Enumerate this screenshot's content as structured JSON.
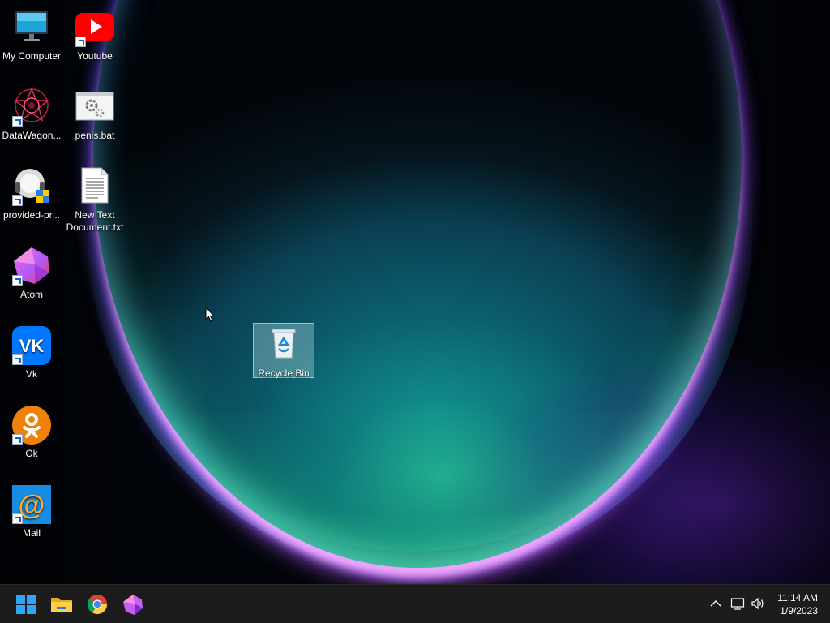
{
  "desktop": {
    "icons": [
      {
        "label": "My Computer",
        "icon": "monitor-icon"
      },
      {
        "label": "Youtube",
        "icon": "youtube-icon"
      },
      {
        "label": "DataWagon...",
        "icon": "datawagon-icon"
      },
      {
        "label": "penis.bat",
        "icon": "bat-file-icon"
      },
      {
        "label": "provided-pr...",
        "icon": "provided-app-icon"
      },
      {
        "label": "New Text Document.txt",
        "icon": "text-file-icon"
      },
      {
        "label": "Atom",
        "icon": "atom-icon"
      },
      {
        "label": "Vk",
        "icon": "vk-icon"
      },
      {
        "label": "Ok",
        "icon": "ok-icon"
      },
      {
        "label": "Mail",
        "icon": "mail-icon"
      },
      {
        "label": "Recycle Bin",
        "icon": "recycle-bin-icon"
      }
    ]
  },
  "taskbar": {
    "apps": [
      {
        "name": "Start",
        "icon": "windows-start-icon"
      },
      {
        "name": "File Explorer",
        "icon": "folder-icon"
      },
      {
        "name": "Google Chrome",
        "icon": "chrome-icon"
      },
      {
        "name": "Atom",
        "icon": "atom-icon"
      }
    ],
    "tray": {
      "time": "11:14 AM",
      "date": "1/9/2023"
    }
  },
  "colors": {
    "taskbar_bg": "#1c1c1c",
    "youtube_red": "#ff0000",
    "vk_blue": "#0077ff",
    "ok_orange": "#ee8208",
    "mail_blue": "#168de2",
    "start_blue": "#2fa6f5"
  }
}
